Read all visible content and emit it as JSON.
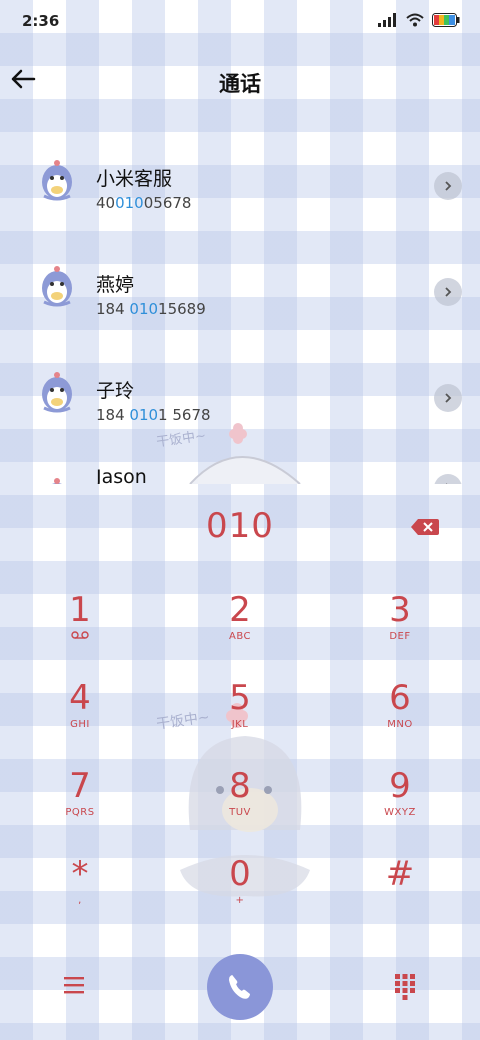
{
  "status_bar": {
    "time": "2:36"
  },
  "header": {
    "title": "通话"
  },
  "contacts": [
    {
      "name": "小米客服",
      "number_parts": [
        "40",
        "010",
        "05678"
      ]
    },
    {
      "name": "燕婷",
      "number_parts": [
        "184 ",
        "010",
        "15689"
      ]
    },
    {
      "name": "子玲",
      "number_parts": [
        "184 ",
        "010",
        "1 5678"
      ]
    },
    {
      "name": "Jason",
      "number_parts": [
        "",
        "",
        ""
      ]
    }
  ],
  "watermark_text": "干饭中~",
  "dialer": {
    "number": "010"
  },
  "keys": [
    {
      "digit": "1",
      "letters": ""
    },
    {
      "digit": "2",
      "letters": "ABC"
    },
    {
      "digit": "3",
      "letters": "DEF"
    },
    {
      "digit": "4",
      "letters": "GHI"
    },
    {
      "digit": "5",
      "letters": "JKL"
    },
    {
      "digit": "6",
      "letters": "MNO"
    },
    {
      "digit": "7",
      "letters": "PQRS"
    },
    {
      "digit": "8",
      "letters": "TUV"
    },
    {
      "digit": "9",
      "letters": "WXYZ"
    },
    {
      "digit": "*",
      "letters": ","
    },
    {
      "digit": "0",
      "letters": "+"
    },
    {
      "digit": "#",
      "letters": ""
    }
  ],
  "colors": {
    "accent": "#c9474d",
    "call": "#8a96d8",
    "highlight": "#2f8fd9"
  }
}
